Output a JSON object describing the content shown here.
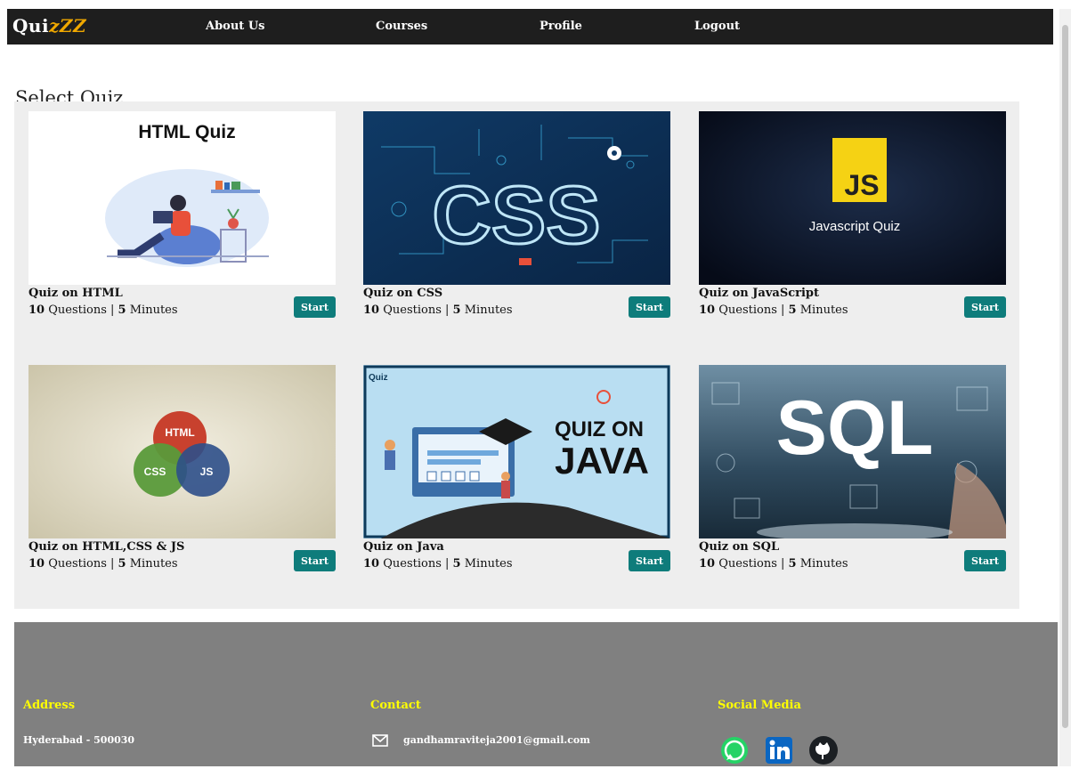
{
  "brand": {
    "name_part1": "Qui",
    "name_part2": "zZZ",
    "accent_color": "#f0a800"
  },
  "nav": {
    "about": "About Us",
    "courses": "Courses",
    "profile": "Profile",
    "logout": "Logout"
  },
  "page_title": "Select Quiz",
  "quizzes": [
    {
      "title": "Quiz on HTML",
      "questions": "10",
      "q_label": "Questions",
      "minutes": "5",
      "m_label": "Minutes",
      "button": "Start",
      "image_text": "HTML Quiz"
    },
    {
      "title": "Quiz on CSS",
      "questions": "10",
      "q_label": "Questions",
      "minutes": "5",
      "m_label": "Minutes",
      "button": "Start",
      "image_text": "CSS"
    },
    {
      "title": "Quiz on JavaScript",
      "questions": "10",
      "q_label": "Questions",
      "minutes": "5",
      "m_label": "Minutes",
      "button": "Start",
      "image_text": "Javascript Quiz",
      "image_badge": "JS"
    },
    {
      "title": "Quiz on HTML,CSS & JS",
      "questions": "10",
      "q_label": "Questions",
      "minutes": "5",
      "m_label": "Minutes",
      "button": "Start",
      "image_labels": [
        "HTML",
        "CSS",
        "JS"
      ]
    },
    {
      "title": "Quiz on Java",
      "questions": "10",
      "q_label": "Questions",
      "minutes": "5",
      "m_label": "Minutes",
      "button": "Start",
      "image_text_line1": "QUIZ ON",
      "image_text_line2": "JAVA",
      "image_logo": "Quiz"
    },
    {
      "title": "Quiz on SQL",
      "questions": "10",
      "q_label": "Questions",
      "minutes": "5",
      "m_label": "Minutes",
      "button": "Start",
      "image_text": "SQL"
    }
  ],
  "footer": {
    "address_heading": "Address",
    "address_line1": "Hyderabad - 500030",
    "contact_heading": "Contact",
    "email": "gandhamraviteja2001@gmail.com",
    "social_heading": "Social Media",
    "social_icons": [
      "whatsapp-icon",
      "linkedin-icon",
      "github-icon"
    ]
  },
  "colors": {
    "nav_bg": "#1e1e1e",
    "button": "#0e7c7b",
    "footer_bg": "#808080",
    "footer_heading": "#ffff00"
  }
}
